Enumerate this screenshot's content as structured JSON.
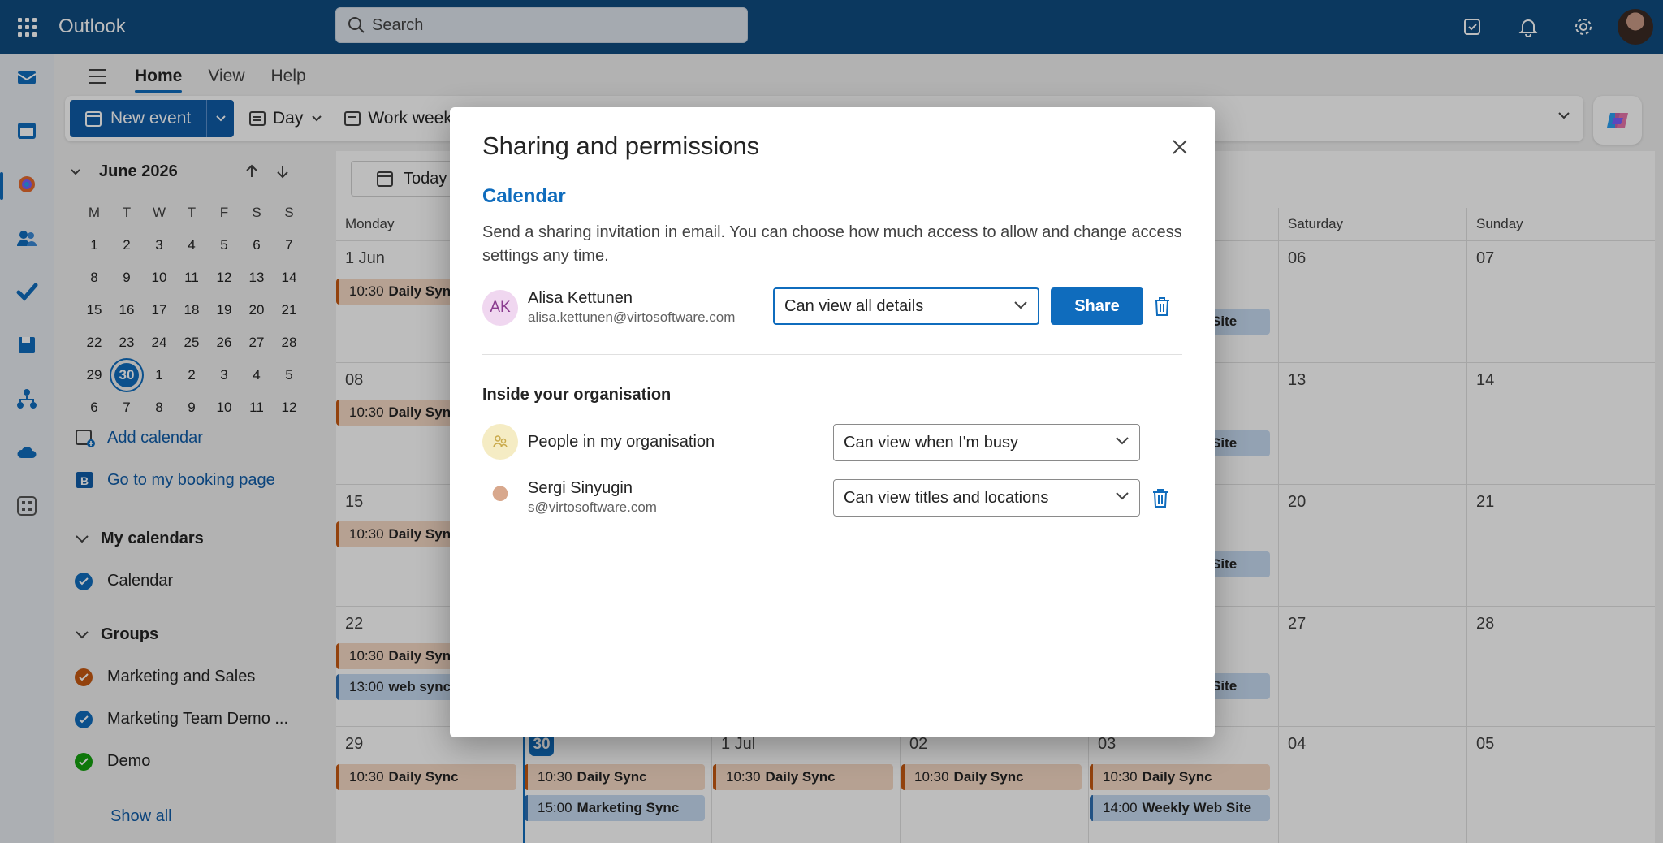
{
  "app": {
    "name": "Outlook"
  },
  "search": {
    "placeholder": "Search"
  },
  "ribbon": {
    "tabs": [
      "Home",
      "View",
      "Help"
    ],
    "new_event": "New event",
    "day": "Day",
    "work_week": "Work week"
  },
  "mini_calendar": {
    "month": "June 2026",
    "dow": [
      "M",
      "T",
      "W",
      "T",
      "F",
      "S",
      "S"
    ],
    "weeks": [
      [
        "1",
        "2",
        "3",
        "4",
        "5",
        "6",
        "7"
      ],
      [
        "8",
        "9",
        "10",
        "11",
        "12",
        "13",
        "14"
      ],
      [
        "15",
        "16",
        "17",
        "18",
        "19",
        "20",
        "21"
      ],
      [
        "22",
        "23",
        "24",
        "25",
        "26",
        "27",
        "28"
      ],
      [
        "29",
        "30",
        "1",
        "2",
        "3",
        "4",
        "5"
      ],
      [
        "6",
        "7",
        "8",
        "9",
        "10",
        "11",
        "12"
      ]
    ],
    "today": "30"
  },
  "left_pane": {
    "add_calendar": "Add calendar",
    "booking_page": "Go to my booking page",
    "my_calendars": "My calendars",
    "calendar": "Calendar",
    "groups": "Groups",
    "group_items": [
      "Marketing and Sales",
      "Marketing Team Demo ...",
      "Demo"
    ],
    "group_colors": [
      "#c75a12",
      "#0f6cbd",
      "#13a10e"
    ],
    "show_all": "Show all"
  },
  "calendar": {
    "today_button": "Today",
    "day_headers": {
      "monday": "Monday",
      "saturday": "Saturday",
      "sunday": "Sunday"
    },
    "dates": {
      "w1_mon": "1 Jun",
      "w1_sat": "06",
      "w1_sun": "07",
      "w2_mon": "08",
      "w2_sat": "13",
      "w2_sun": "14",
      "w3_mon": "15",
      "w3_sat": "20",
      "w3_sun": "21",
      "w4_mon": "22",
      "w4_sat": "27",
      "w4_sun": "28",
      "w5_mon": "29",
      "w5_tue": "30",
      "w5_wed": "1 Jul",
      "w5_thu": "02",
      "w5_fri": "03",
      "w5_sat": "04",
      "w5_sun": "05"
    },
    "events": {
      "daily_time": "10:30",
      "daily_title": "Daily Sync",
      "web_time": "13:00",
      "web_title": "web sync",
      "mkt_time": "15:00",
      "mkt_title": "Marketing Sync",
      "weekly_time": "14:00",
      "weekly_title": "Weekly Web Site",
      "site_partial": "Site"
    }
  },
  "dialog": {
    "title": "Sharing and permissions",
    "section": "Calendar",
    "description": "Send a sharing invitation in email. You can choose how much access to allow and change access settings any time.",
    "invitee": {
      "initials": "AK",
      "name": "Alisa Kettunen",
      "email": "alisa.kettunen@virtosoftware.com",
      "permission": "Can view all details"
    },
    "share_button": "Share",
    "org_heading": "Inside your organisation",
    "org_people": {
      "name": "People in my organisation",
      "permission": "Can view when I'm busy"
    },
    "org_user": {
      "name": "Sergi Sinyugin",
      "email": "s@virtosoftware.com",
      "permission": "Can view titles and locations"
    }
  }
}
